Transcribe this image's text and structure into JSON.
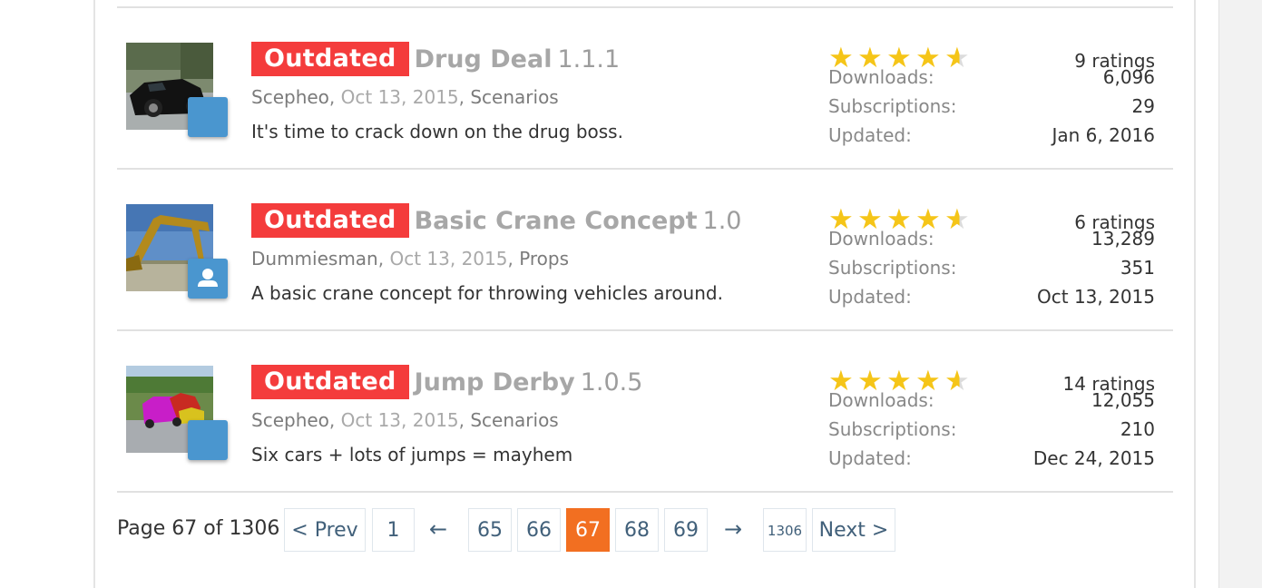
{
  "resources": [
    {
      "badge": "Outdated",
      "title": "Drug Deal",
      "version": "1.1.1",
      "author": "Scepheo",
      "date": "Oct 13, 2015",
      "category": "Scenarios",
      "description": "It's time to crack down on the drug boss.",
      "rating_stars": 4.5,
      "ratings": "9 ratings",
      "downloads_label": "Downloads:",
      "downloads": "6,096",
      "subscriptions_label": "Subscriptions:",
      "subscriptions": "29",
      "updated_label": "Updated:",
      "updated": "Jan 6, 2016",
      "thumb_icon": "black-car-thumbnail",
      "avatar_icon": "blank-avatar"
    },
    {
      "badge": "Outdated",
      "title": "Basic Crane Concept",
      "version": "1.0",
      "author": "Dummiesman",
      "date": "Oct 13, 2015",
      "category": "Props",
      "description": "A basic crane concept for throwing vehicles around.",
      "rating_stars": 4.5,
      "ratings": "6 ratings",
      "downloads_label": "Downloads:",
      "downloads": "13,289",
      "subscriptions_label": "Subscriptions:",
      "subscriptions": "351",
      "updated_label": "Updated:",
      "updated": "Oct 13, 2015",
      "thumb_icon": "crane-thumbnail",
      "avatar_icon": "default-user-avatar"
    },
    {
      "badge": "Outdated",
      "title": "Jump Derby",
      "version": "1.0.5",
      "author": "Scepheo",
      "date": "Oct 13, 2015",
      "category": "Scenarios",
      "description": "Six cars + lots of jumps = mayhem",
      "rating_stars": 4.5,
      "ratings": "14 ratings",
      "downloads_label": "Downloads:",
      "downloads": "12,055",
      "subscriptions_label": "Subscriptions:",
      "subscriptions": "210",
      "updated_label": "Updated:",
      "updated": "Dec 24, 2015",
      "thumb_icon": "derby-cars-thumbnail",
      "avatar_icon": "blank-avatar"
    }
  ],
  "pagination": {
    "label": "Page 67 of 1306",
    "prev": "< Prev",
    "first": "1",
    "ellipsis_left": "←",
    "pages": [
      "65",
      "66",
      "67",
      "68",
      "69"
    ],
    "current": "67",
    "ellipsis_right": "→",
    "last": "1306",
    "next": "Next >"
  },
  "colors": {
    "badge": "#f43c3c",
    "star": "#f5c518",
    "current_page": "#f26f21",
    "avatar": "#4a96cf"
  }
}
